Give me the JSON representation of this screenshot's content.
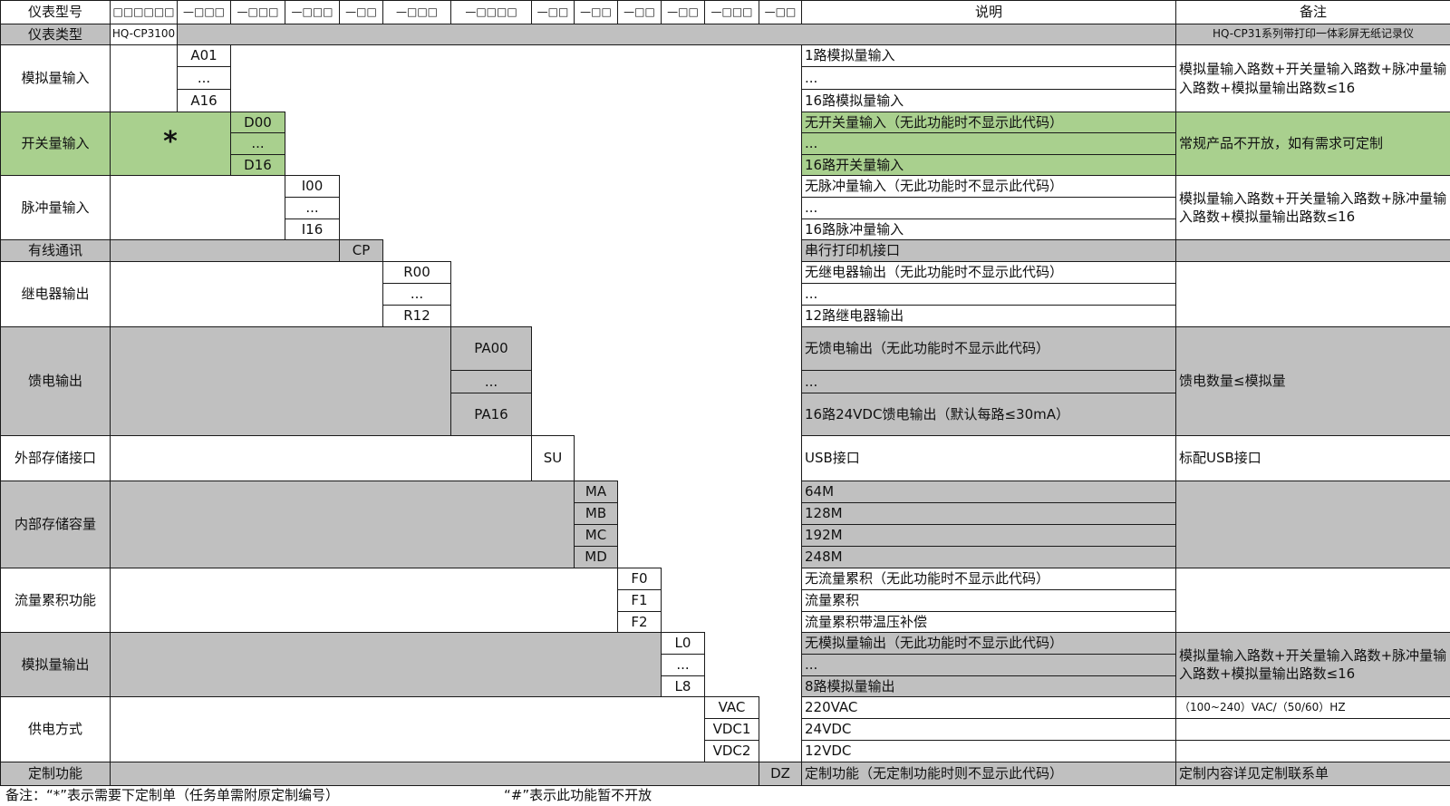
{
  "header": {
    "c0": "仪表型号",
    "codes": [
      "□□□□□□",
      "—□□□",
      "—□□□",
      "—□□□",
      "—□□",
      "—□□□",
      "—□□□□",
      "—□□",
      "—□□",
      "—□□",
      "—□□",
      "—□□□",
      "—□□"
    ],
    "desc": "说明",
    "note": "备注"
  },
  "rows": {
    "type": {
      "label": "仪表类型",
      "model": "HQ-CP3100",
      "note": "HQ-CP31系列带打印一体彩屏无纸记录仪"
    },
    "analog_in": {
      "label": "模拟量输入",
      "codes": [
        "A01",
        "...",
        "A16"
      ],
      "desc": [
        "1路模拟量输入",
        "...",
        "16路模拟量输入"
      ],
      "note": "模拟量输入路数+开关量输入路数+脉冲量输入路数+模拟量输出路数≤16"
    },
    "switch_in": {
      "label": "开关量输入",
      "star": "*",
      "codes": [
        "D00",
        "...",
        "D16"
      ],
      "desc": [
        "无开关量输入（无此功能时不显示此代码）",
        "...",
        "16路开关量输入"
      ],
      "note": "常规产品不开放，如有需求可定制"
    },
    "pulse_in": {
      "label": "脉冲量输入",
      "codes": [
        "I00",
        "...",
        "I16"
      ],
      "desc": [
        "无脉冲量输入（无此功能时不显示此代码）",
        "...",
        "16路脉冲量输入"
      ],
      "note": "模拟量输入路数+开关量输入路数+脉冲量输入路数+模拟量输出路数≤16"
    },
    "wired": {
      "label": "有线通讯",
      "code": "CP",
      "desc": "串行打印机接口"
    },
    "relay": {
      "label": "继电器输出",
      "codes": [
        "R00",
        "...",
        "R12"
      ],
      "desc": [
        "无继电器输出（无此功能时不显示此代码）",
        "...",
        "12路继电器输出"
      ]
    },
    "feed": {
      "label": "馈电输出",
      "codes": [
        "PA00",
        "...",
        "PA16"
      ],
      "desc": [
        "无馈电输出（无此功能时不显示此代码）",
        "...",
        "16路24VDC馈电输出（默认每路≤30mA）"
      ],
      "note": "馈电数量≤模拟量"
    },
    "ext_storage": {
      "label": "外部存储接口",
      "code": "SU",
      "desc": "USB接口",
      "note": "标配USB接口"
    },
    "int_storage": {
      "label": "内部存储容量",
      "codes": [
        "MA",
        "MB",
        "MC",
        "MD"
      ],
      "desc": [
        "64M",
        "128M",
        "192M",
        "248M"
      ]
    },
    "flow": {
      "label": "流量累积功能",
      "codes": [
        "F0",
        "F1",
        "F2"
      ],
      "desc": [
        "无流量累积（无此功能时不显示此代码）",
        "流量累积",
        "流量累积带温压补偿"
      ]
    },
    "analog_out": {
      "label": "模拟量输出",
      "codes": [
        "L0",
        "...",
        "L8"
      ],
      "desc": [
        "无模拟量输出（无此功能时不显示此代码）",
        "...",
        "8路模拟量输出"
      ],
      "note": "模拟量输入路数+开关量输入路数+脉冲量输入路数+模拟量输出路数≤16"
    },
    "power": {
      "label": "供电方式",
      "codes": [
        "VAC",
        "VDC1",
        "VDC2"
      ],
      "desc": [
        "220VAC",
        "24VDC",
        "12VDC"
      ],
      "note": "（100~240）VAC/（50/60）HZ"
    },
    "custom": {
      "label": "定制功能",
      "code": "DZ",
      "desc": "定制功能（无定制功能时则不显示此代码）",
      "note": "定制内容详见定制联系单"
    }
  },
  "footer": {
    "note1": "备注：“*”表示需要下定制单（任务单需附原定制编号）",
    "note2": "“#”表示此功能暂不开放"
  },
  "colors": {
    "gray": "#c0c0c0",
    "green": "#a9d08e",
    "white": "#ffffff"
  }
}
